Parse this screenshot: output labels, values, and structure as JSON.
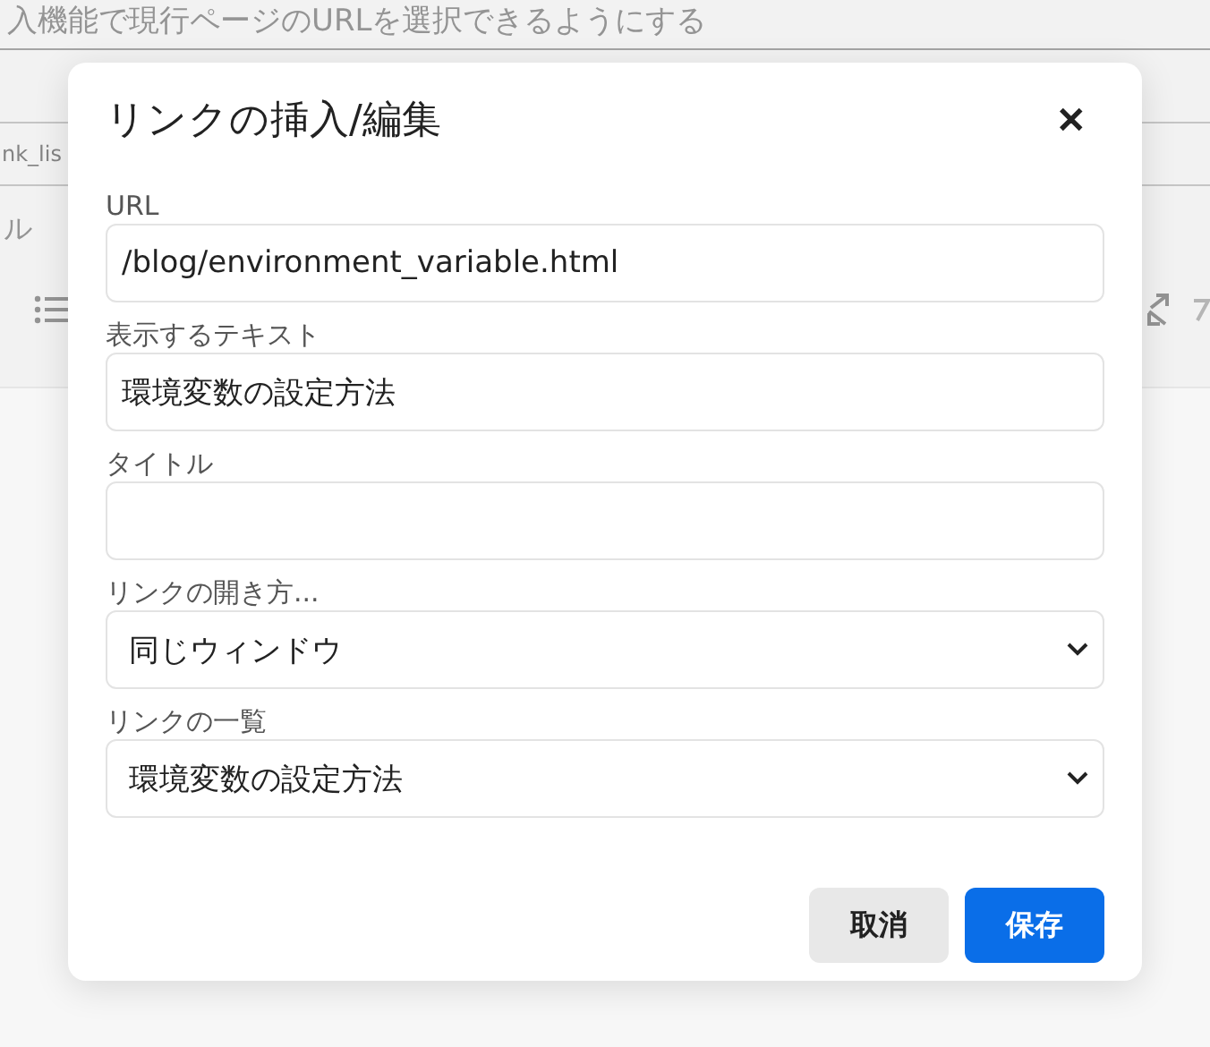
{
  "background": {
    "heading": "入機能で現行ページのURLを選択できるようにする",
    "field_value": "nk_lis",
    "label": "ル"
  },
  "dialog": {
    "title": "リンクの挿入/編集",
    "close": "✕",
    "fields": [
      {
        "kind": "text",
        "label": "URL",
        "value": "/blog/environment_variable.html"
      },
      {
        "kind": "text",
        "label": "表示するテキスト",
        "value": "環境変数の設定方法"
      },
      {
        "kind": "text",
        "label": "タイトル"
      },
      {
        "kind": "select",
        "label": "リンクの開き方...",
        "value": "同じウィンドウ"
      },
      {
        "kind": "select",
        "label": "リンクの一覧",
        "value": "環境変数の設定方法"
      }
    ],
    "buttons": [
      {
        "label": "取消",
        "kind": "secondary"
      },
      {
        "label": "保存",
        "kind": "primary"
      }
    ]
  }
}
